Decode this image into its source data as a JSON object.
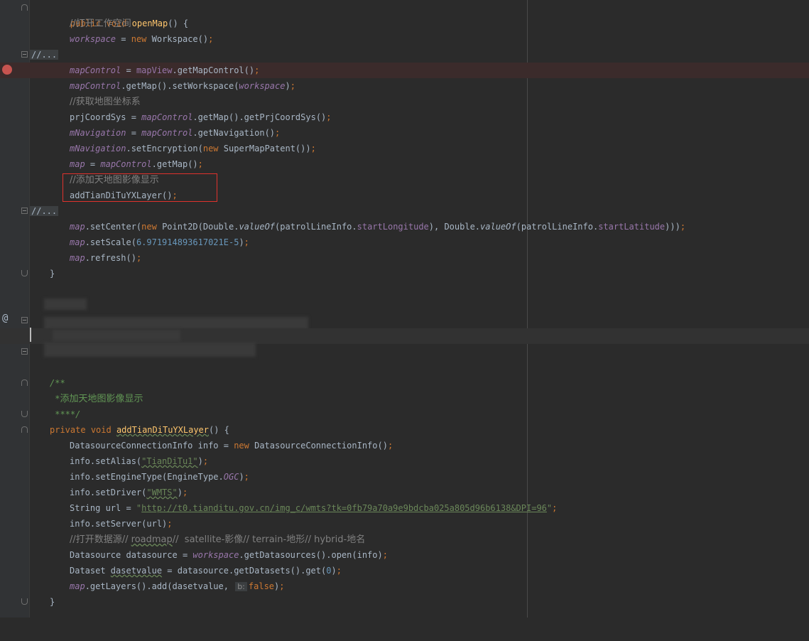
{
  "editor": {
    "lines": {
      "l1": {
        "kw1": "public",
        "kw2": "void",
        "fn": "openMap",
        "rest": "() {"
      },
      "l2": {
        "comment": "//打开工作空间"
      },
      "l3": {
        "field": "workspace",
        "eq": " = ",
        "kw": "new",
        "rest": " Workspace()",
        "semi": ";"
      },
      "l4": {
        "collapsed": "//..."
      },
      "l5": {
        "field": "mapControl",
        "eq": " = ",
        "field2": "mapView",
        "rest": ".getMapControl()",
        "semi": ";"
      },
      "l6": {
        "field": "mapControl",
        "rest1": ".getMap().setWorkspace(",
        "field2": "workspace",
        "rest2": ")",
        "semi": ";"
      },
      "l7": {
        "comment": "//获取地图坐标系"
      },
      "l8": {
        "field": "prjCoordSys",
        "eq": " = ",
        "field2": "mapControl",
        "rest": ".getMap().getPrjCoordSys()",
        "semi": ";"
      },
      "l9": {
        "field": "mNavigation",
        "eq": " = ",
        "field2": "mapControl",
        "rest": ".getNavigation()",
        "semi": ";"
      },
      "l10": {
        "field": "mNavigation",
        "rest1": ".setEncryption(",
        "kw": "new",
        "rest2": " SuperMapPatent())",
        "semi": ";"
      },
      "l11": {
        "field": "map",
        "eq": " = ",
        "field2": "mapControl",
        "rest": ".getMap()",
        "semi": ";"
      },
      "l12": {
        "comment": "//添加天地图影像显示"
      },
      "l13": {
        "code": "addTianDiTuYXLayer()",
        "semi": ";"
      },
      "l14": {
        "collapsed": "//..."
      },
      "l15": {
        "field": "map",
        "rest1": ".setCenter(",
        "kw": "new",
        "rest2": " Point2D(Double.",
        "stat1": "valueOf",
        "rest3": "(patrolLineInfo.",
        "f1": "startLongitude",
        "rest4": "), Double.",
        "stat2": "valueOf",
        "rest5": "(patrolLineInfo.",
        "f2": "startLatitude",
        "rest6": ")))",
        "semi": ";"
      },
      "l16": {
        "field": "map",
        "rest1": ".setScale(",
        "num": "6.971914893617021E-5",
        "rest2": ")",
        "semi": ";"
      },
      "l17": {
        "field": "map",
        "rest1": ".refresh()",
        "semi": ";"
      },
      "l18": {
        "code": "}"
      },
      "l24": {
        "doc": "/**"
      },
      "l25": {
        "doc": " *",
        "doccn": "添加天地图影像显示"
      },
      "l26": {
        "doc": " ****/"
      },
      "l27": {
        "kw1": "private",
        "kw2": "void",
        "fn": "addTianDiTuYXLayer",
        "rest": "() {"
      },
      "l28": {
        "rest1": "DatasourceConnectionInfo info = ",
        "kw": "new",
        "rest2": " DatasourceConnectionInfo()",
        "semi": ";"
      },
      "l29": {
        "rest1": "info.setAlias(",
        "str": "\"TianDiTu1\"",
        "rest2": ")",
        "semi": ";"
      },
      "l30": {
        "rest1": "info.setEngineType(EngineType.",
        "stat": "OGC",
        "rest2": ")",
        "semi": ";"
      },
      "l31": {
        "rest1": "info.setDriver(",
        "str": "\"WMTS\"",
        "rest2": ")",
        "semi": ";"
      },
      "l32": {
        "rest1": "String url = ",
        "q1": "\"",
        "url": "http://t0.tianditu.gov.cn/img_c/wmts?tk=0fb79a70a9e9bdcba025a805d96b6138&DPI=96",
        "q2": "\"",
        "semi": ";"
      },
      "l33": {
        "rest1": "info.setServer(url)",
        "semi": ";"
      },
      "l34": {
        "c1": "//打开数据源// ",
        "roadmap": "roadmap",
        "c2": "//  satellite-影像// terrain-地形// hybrid-地名"
      },
      "l35": {
        "rest1": "Datasource datasource = ",
        "field": "workspace",
        "rest2": ".getDatasources().open(info)",
        "semi": ";"
      },
      "l36": {
        "rest1": "Dataset ",
        "var": "dasetvalue",
        "rest2": " = datasource.getDatasets().get(",
        "num": "0",
        "rest3": ")",
        "semi": ";"
      },
      "l37": {
        "field": "map",
        "rest1": ".getLayers().add(dasetvalue, ",
        "hint": "b:",
        "kw": "false",
        "rest2": ")",
        "semi": ";"
      },
      "l38": {
        "code": "}"
      }
    }
  },
  "colors": {
    "background": "#2b2b2b",
    "keyword": "#cc7832",
    "function": "#ffc66d",
    "field": "#9876aa",
    "number": "#6897bb",
    "string": "#6a8759",
    "comment": "#808080",
    "breakpoint": "#c75450",
    "highlight": "#e0322d"
  },
  "icons": {
    "breakpoint": "breakpoint-icon",
    "override": "at-icon",
    "fold": "fold-icon"
  }
}
